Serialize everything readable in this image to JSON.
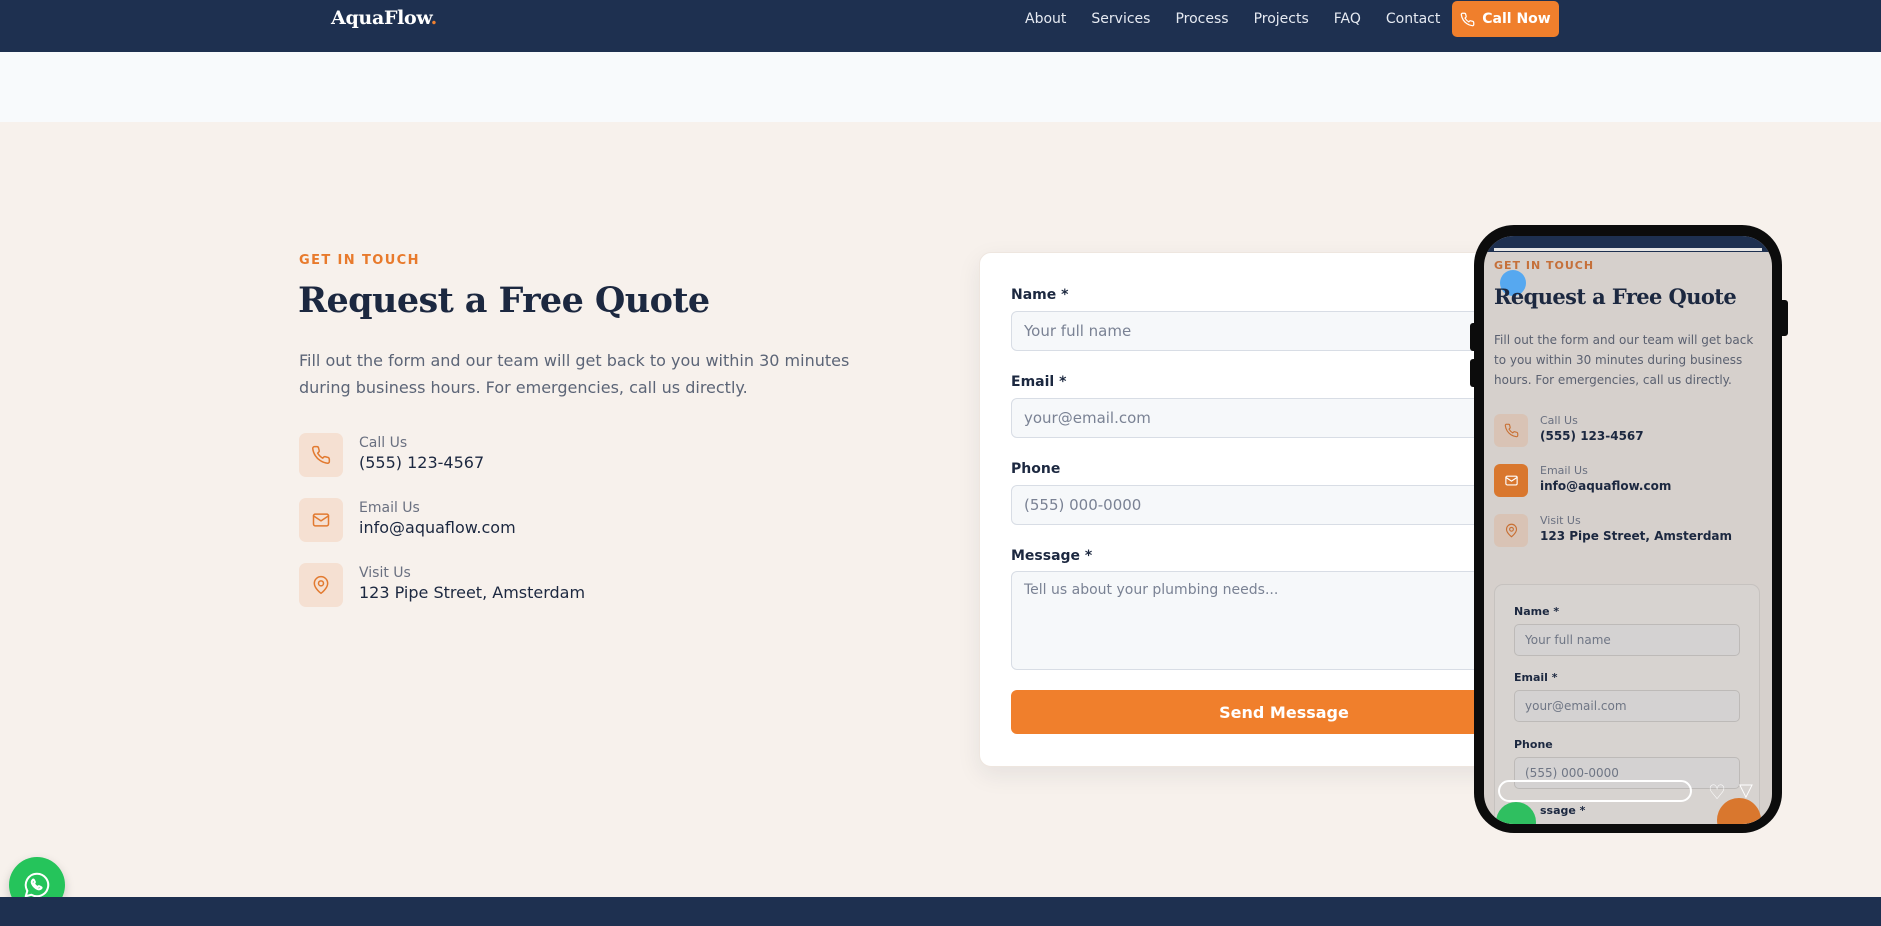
{
  "nav": {
    "logo_text": "AquaFlow",
    "logo_dot": ".",
    "links": [
      "About",
      "Services",
      "Process",
      "Projects",
      "FAQ",
      "Contact"
    ],
    "cta_label": "Call Now"
  },
  "section": {
    "eyebrow": "GET IN TOUCH",
    "title": "Request a Free Quote",
    "lede": "Fill out the form and our team will get back to you within 30 minutes during business hours. For emergencies, call us directly."
  },
  "contacts": [
    {
      "label": "Call Us",
      "value": "(555) 123-4567",
      "icon": "phone-icon"
    },
    {
      "label": "Email Us",
      "value": "info@aquaflow.com",
      "icon": "mail-icon"
    },
    {
      "label": "Visit Us",
      "value": "123 Pipe Street, Amsterdam",
      "icon": "map-pin-icon"
    }
  ],
  "form": {
    "name_label": "Name *",
    "name_placeholder": "Your full name",
    "email_label": "Email *",
    "email_placeholder": "your@email.com",
    "phone_label": "Phone",
    "phone_placeholder": "(555) 000-0000",
    "message_label": "Message *",
    "message_placeholder": "Tell us about your plumbing needs...",
    "submit_label": "Send Message"
  },
  "mobile_preview": {
    "eyebrow": "GET IN TOUCH",
    "title": "Request a Free Quote",
    "lede": "Fill out the form and our team will get back to you within 30 minutes during business hours. For emergencies, call us directly.",
    "contacts": [
      {
        "label": "Call Us",
        "value": "(555) 123-4567"
      },
      {
        "label": "Email Us",
        "value": "info@aquaflow.com"
      },
      {
        "label": "Visit Us",
        "value": "123 Pipe Street, Amsterdam"
      }
    ],
    "name_label": "Name *",
    "name_placeholder": "Your full name",
    "email_label": "Email *",
    "email_placeholder": "your@email.com",
    "phone_label": "Phone",
    "phone_placeholder": "(555) 000-0000",
    "message_label_partial": "ssage *"
  },
  "colors": {
    "navy": "#1e3050",
    "accent": "#f07f2c",
    "whatsapp": "#25c45b",
    "background": "#f7f1ec"
  }
}
